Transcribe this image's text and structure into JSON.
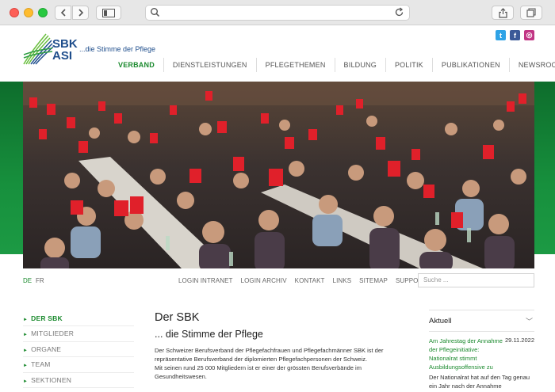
{
  "browser": {
    "icons": [
      "back-icon",
      "forward-icon",
      "sidebar-icon",
      "search-icon",
      "reload-icon",
      "share-icon",
      "tabs-icon"
    ]
  },
  "header": {
    "logo_line1": "SBK",
    "logo_line2": "ASI",
    "tagline": "...die Stimme der Pflege",
    "social": [
      "twitter",
      "facebook",
      "instagram"
    ],
    "accent_color": "#1b8a2e",
    "brand_color": "#1f4e8c"
  },
  "nav": {
    "items": [
      "VERBAND",
      "DIENSTLEISTUNGEN",
      "PFLEGETHEMEN",
      "BILDUNG",
      "POLITIK",
      "PUBLIKATIONEN",
      "NEWSROOM"
    ],
    "active": "VERBAND"
  },
  "languages": [
    "DE",
    "FR"
  ],
  "utility": [
    "LOGIN INTRANET",
    "LOGIN ARCHIV",
    "KONTAKT",
    "LINKS",
    "SITEMAP",
    "SUPPORT"
  ],
  "search": {
    "placeholder": "Suche ..."
  },
  "sidebar": {
    "items": [
      "DER SBK",
      "MITGLIEDER",
      "ORGANE",
      "TEAM",
      "SEKTIONEN"
    ]
  },
  "main": {
    "title": "Der SBK",
    "subtitle": "... die Stimme der Pflege",
    "paragraph1": "Der Schweizer Berufsverband der Pflegefachfrauen und Pflegefachmänner SBK ist der repräsentative Berufsverband der diplomierten Pflegefachpersonen der Schweiz.",
    "paragraph2": "Mit seinen rund 25 000 Mitgliedern ist er einer der grössten Berufsverbände im Gesundheitswesen."
  },
  "news": {
    "heading": "Aktuell",
    "date": "29.11.2022",
    "title": "Am Jahrestag der Annahme der Pflegeinitiative: Nationalrat stimmt Ausbildungsoffensive zu",
    "text": "Der Nationalrat hat auf den Tag genau ein Jahr nach der Annahme"
  }
}
